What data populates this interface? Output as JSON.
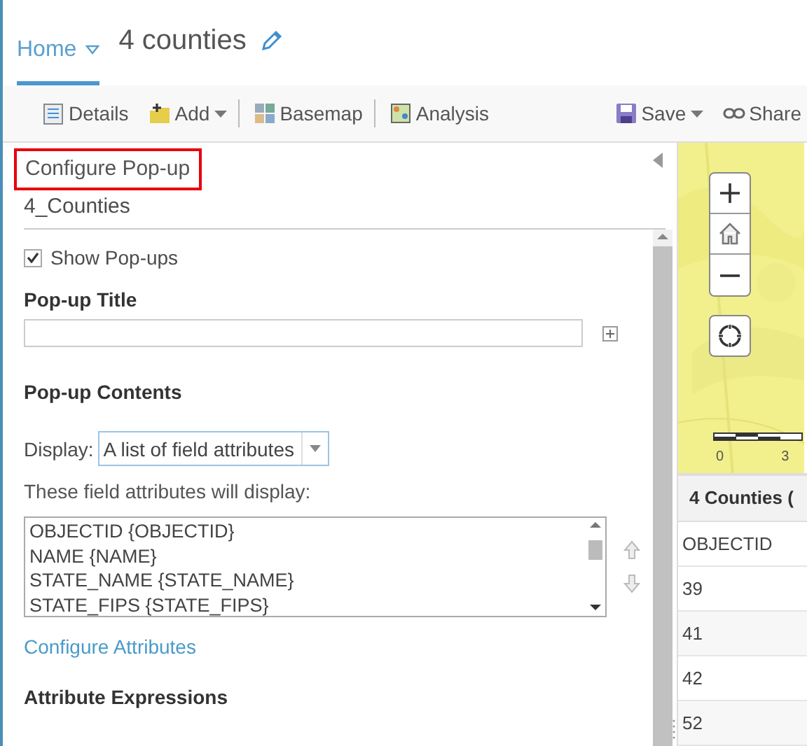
{
  "header": {
    "home_tab": {
      "label": "Home",
      "selected": true
    },
    "map_title": "4 counties"
  },
  "toolbar": [
    {
      "label": "Details",
      "kind": "details",
      "dropdown": false,
      "divider_after": false
    },
    {
      "label": "Add",
      "kind": "add",
      "dropdown": true,
      "divider_after": true
    },
    {
      "label": "Basemap",
      "kind": "basemap",
      "dropdown": false,
      "divider_after": true
    },
    {
      "label": "Analysis",
      "kind": "analysis",
      "dropdown": false,
      "divider_after": false
    },
    {
      "label": "Save",
      "kind": "save",
      "dropdown": true,
      "divider_after": false
    },
    {
      "label": "Share",
      "kind": "share",
      "dropdown": false,
      "divider_after": false
    }
  ],
  "panel": {
    "title": "Configure Pop-up",
    "highlighted": true,
    "layer": "4_Counties",
    "show_popups": {
      "label": "Show Pop-ups",
      "checked": true
    },
    "title_heading": "Pop-up Title",
    "contents_heading": "Pop-up Contents",
    "display": {
      "label": "Display:",
      "value": "A list of field attributes"
    },
    "fields_caption": "These field attributes will display:",
    "fields": [
      "OBJECTID {OBJECTID}",
      "NAME {NAME}",
      "STATE_NAME {STATE_NAME}",
      "STATE_FIPS {STATE_FIPS}"
    ],
    "configure_link": "Configure Attributes",
    "expressions_heading": "Attribute Expressions"
  },
  "map": {
    "scale_labels": [
      "0",
      "3"
    ]
  },
  "table": {
    "title": "4 Counties (",
    "columns": [
      "OBJECTID"
    ],
    "rows": [
      [
        "39"
      ],
      [
        "41"
      ],
      [
        "42"
      ],
      [
        "52"
      ]
    ]
  }
}
